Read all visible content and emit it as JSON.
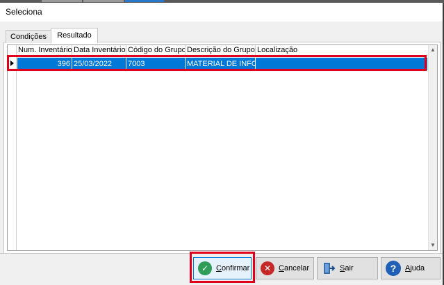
{
  "window": {
    "title": "Seleciona"
  },
  "tabs": [
    {
      "label": "Condições",
      "active": false
    },
    {
      "label": "Resultado",
      "active": true
    }
  ],
  "grid": {
    "columns": [
      "Num. Inventário",
      "Data Inventário",
      "Código do Grupo",
      "Descrição do Grupo",
      "Localização"
    ],
    "rows": [
      {
        "num_inventario": "396",
        "data_inventario": "25/03/2022",
        "codigo_grupo": "7003",
        "descricao_grupo": "MATERIAL DE INFOR",
        "localizacao": ""
      }
    ],
    "selected_row_color": "#0078d7"
  },
  "buttons": {
    "confirmar": {
      "underline": "C",
      "rest": "onfirmar",
      "icon": "check-circle-icon"
    },
    "cancelar": {
      "underline": "C",
      "rest": "ancelar",
      "icon": "x-circle-icon"
    },
    "sair": {
      "underline": "S",
      "rest": "air",
      "icon": "exit-door-icon"
    },
    "ajuda": {
      "underline": "A",
      "rest": "juda",
      "icon": "help-icon"
    }
  },
  "colors": {
    "highlight": "#e0001b",
    "accent": "#0078d7"
  }
}
